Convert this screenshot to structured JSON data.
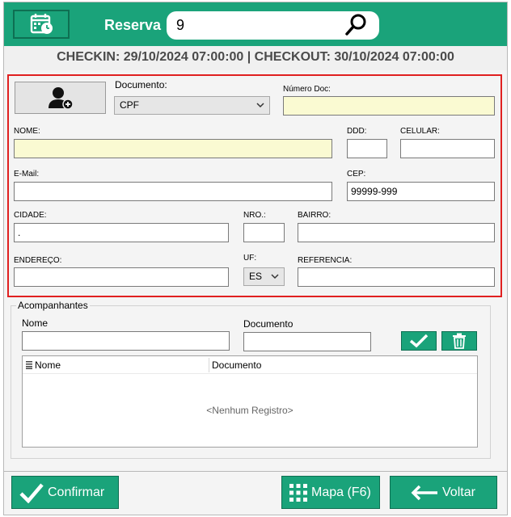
{
  "header": {
    "reserva_label": "Reserva",
    "reserva_value": "9",
    "bg_color": "#1aa37a"
  },
  "checkin_bar": {
    "text": "CHECKIN: 29/10/2024 07:00:00 | CHECKOUT: 30/10/2024 07:00:00"
  },
  "form": {
    "documento_label": "Documento:",
    "documento_selected": "CPF",
    "numero_doc_label": "Número Doc:",
    "numero_doc_value": "",
    "nome_label": "NOME:",
    "nome_value": "",
    "ddd_label": "DDD:",
    "ddd_value": "",
    "celular_label": "CELULAR:",
    "celular_value": "",
    "email_label": "E-Mail:",
    "email_value": "",
    "cep_label": "CEP:",
    "cep_value": "99999-999",
    "cidade_label": "CIDADE:",
    "cidade_value": ".",
    "nro_label": "NRO.:",
    "nro_value": "",
    "bairro_label": "BAIRRO:",
    "bairro_value": "",
    "endereco_label": "ENDEREÇO:",
    "endereco_value": "",
    "uf_label": "UF:",
    "uf_selected": "ES",
    "referencia_label": "REFERENCIA:",
    "referencia_value": ""
  },
  "acompanhantes": {
    "title": "Acompanhantes",
    "nome_label": "Nome",
    "documento_label": "Documento",
    "grid": {
      "columns": [
        "Nome",
        "Documento"
      ],
      "empty_text": "<Nenhum Registro>"
    }
  },
  "footer": {
    "confirmar_label": "Confirmar",
    "mapa_label": "Mapa (F6)",
    "voltar_label": "Voltar"
  },
  "colors": {
    "accent": "#1aa37a",
    "highlight_border": "#e02020",
    "required_field": "#fafad2"
  }
}
